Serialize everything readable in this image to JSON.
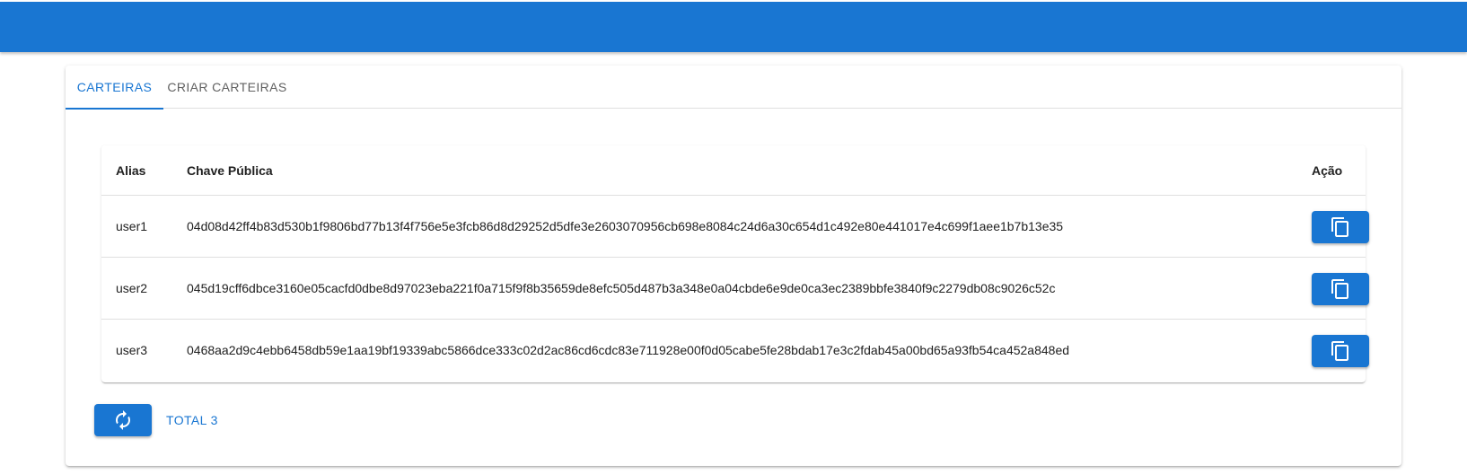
{
  "colors": {
    "primary": "#1976d2",
    "inactive_tab": "#616161",
    "divider": "#e0e0e0"
  },
  "tabs": [
    {
      "label": "CARTEIRAS",
      "active": true
    },
    {
      "label": "CRIAR CARTEIRAS",
      "active": false
    }
  ],
  "table": {
    "headers": {
      "alias": "Alias",
      "public_key": "Chave Pública",
      "action": "Ação"
    },
    "rows": [
      {
        "alias": "user1",
        "public_key": "04d08d42ff4b83d530b1f9806bd77b13f4f756e5e3fcb86d8d29252d5dfe3e2603070956cb698e8084c24d6a30c654d1c492e80e441017e4c699f1aee1b7b13e35",
        "action_icon": "copy-icon"
      },
      {
        "alias": "user2",
        "public_key": "045d19cff6dbce3160e05cacfd0dbe8d97023eba221f0a715f9f8b35659de8efc505d487b3a348e0a04cbde6e9de0ca3ec2389bbfe3840f9c2279db08c9026c52c",
        "action_icon": "copy-icon"
      },
      {
        "alias": "user3",
        "public_key": "0468aa2d9c4ebb6458db59e1aa19bf19339abc5866dce333c02d2ac86cd6cdc83e711928e00f0d05cabe5fe28bdab17e3c2fdab45a00bd65a93fb54ca452a848ed",
        "action_icon": "copy-icon"
      }
    ]
  },
  "footer": {
    "refresh_icon": "refresh-icon",
    "total_label": "TOTAL 3"
  }
}
